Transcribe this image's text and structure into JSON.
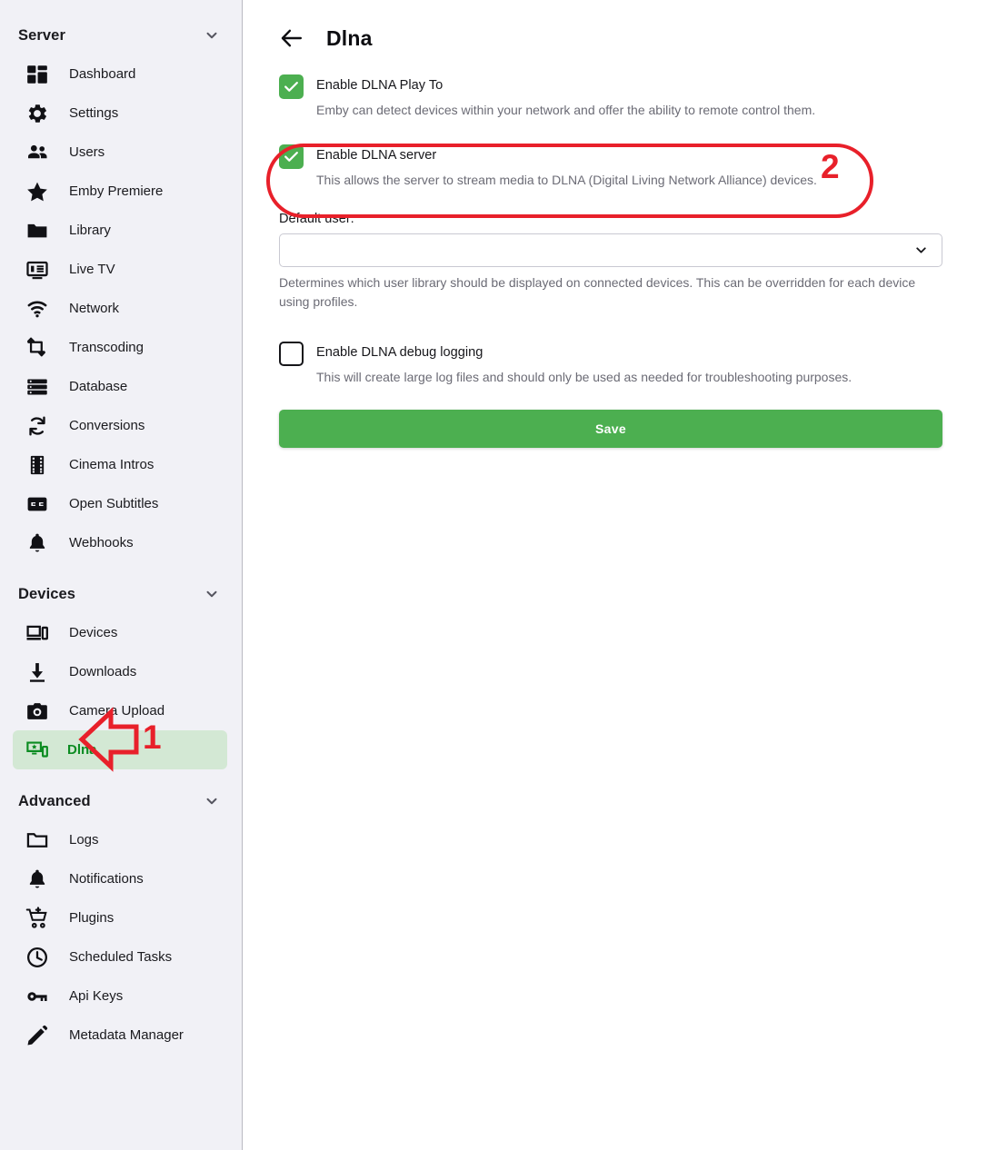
{
  "sidebar": {
    "sections": [
      {
        "title": "Server",
        "chevron_icon": "chevron-down-icon",
        "items": [
          {
            "label": "Dashboard",
            "icon": "dashboard-icon"
          },
          {
            "label": "Settings",
            "icon": "gear-icon"
          },
          {
            "label": "Users",
            "icon": "users-icon"
          },
          {
            "label": "Emby Premiere",
            "icon": "star-icon"
          },
          {
            "label": "Library",
            "icon": "folder-icon"
          },
          {
            "label": "Live TV",
            "icon": "live-tv-icon"
          },
          {
            "label": "Network",
            "icon": "wifi-icon"
          },
          {
            "label": "Transcoding",
            "icon": "transcode-icon"
          },
          {
            "label": "Database",
            "icon": "database-icon"
          },
          {
            "label": "Conversions",
            "icon": "sync-icon"
          },
          {
            "label": "Cinema Intros",
            "icon": "film-strip-icon"
          },
          {
            "label": "Open Subtitles",
            "icon": "closed-caption-icon"
          },
          {
            "label": "Webhooks",
            "icon": "bell-icon"
          }
        ]
      },
      {
        "title": "Devices",
        "chevron_icon": "chevron-down-icon",
        "items": [
          {
            "label": "Devices",
            "icon": "devices-icon"
          },
          {
            "label": "Downloads",
            "icon": "download-icon"
          },
          {
            "label": "Camera Upload",
            "icon": "camera-icon"
          },
          {
            "label": "Dlna",
            "icon": "dlna-icon",
            "active": true
          }
        ]
      },
      {
        "title": "Advanced",
        "chevron_icon": "chevron-down-icon",
        "items": [
          {
            "label": "Logs",
            "icon": "folder-icon"
          },
          {
            "label": "Notifications",
            "icon": "bell-icon"
          },
          {
            "label": "Plugins",
            "icon": "plugin-cart-icon"
          },
          {
            "label": "Scheduled Tasks",
            "icon": "clock-icon"
          },
          {
            "label": "Api Keys",
            "icon": "key-icon"
          },
          {
            "label": "Metadata Manager",
            "icon": "pencil-icon"
          }
        ]
      }
    ]
  },
  "header": {
    "back_icon": "arrow-left-icon",
    "title": "Dlna"
  },
  "form": {
    "play_to": {
      "label": "Enable DLNA Play To",
      "description": "Emby can detect devices within your network and offer the ability to remote control them.",
      "checked": true,
      "check_icon": "checkmark-icon"
    },
    "dlna_server": {
      "label": "Enable DLNA server",
      "description": "This allows the server to stream media to DLNA (Digital Living Network Alliance) devices.",
      "checked": true,
      "check_icon": "checkmark-icon"
    },
    "default_user": {
      "label": "Default user:",
      "value": "",
      "placeholder": "",
      "chevron_icon": "chevron-down-icon",
      "description": "Determines which user library should be displayed on connected devices. This can be overridden for each device using profiles."
    },
    "debug_logging": {
      "label": "Enable DLNA debug logging",
      "description": "This will create large log files and should only be used as needed for troubleshooting purposes.",
      "checked": false
    },
    "save_label": "Save"
  },
  "annotations": {
    "step1": {
      "number": "1",
      "icon": "left-arrow-annotation",
      "target": "sidebar-item-dlna"
    },
    "step2": {
      "number": "2",
      "icon": "ellipse-highlight-annotation",
      "target": "enable-dlna-server-row"
    }
  },
  "colors": {
    "accent_green": "#4caf50",
    "active_green_text": "#0c8c22",
    "active_green_bg": "#d3e8d4",
    "annotation_red": "#e8202a",
    "sidebar_bg": "#f1f1f6",
    "main_bg": "#ffffff",
    "muted_text": "#6b6b75"
  }
}
